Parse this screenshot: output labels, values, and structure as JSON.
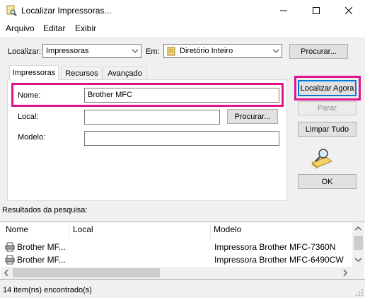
{
  "window": {
    "title": "Localizar Impressoras..."
  },
  "menu": [
    "Arquivo",
    "Editar",
    "Exibir"
  ],
  "search_bar": {
    "localizar_label": "Localizar:",
    "localizar_value": "Impressoras",
    "em_label": "Em:",
    "em_value": "Diretório Inteiro",
    "procurar_label": "Procurar..."
  },
  "tabs": [
    "Impressoras",
    "Recursos",
    "Avançado"
  ],
  "form": {
    "nome_label": "Nome:",
    "nome_value": "Brother MFC",
    "local_label": "Local:",
    "local_value": "",
    "local_procurar_label": "Procurar...",
    "modelo_label": "Modelo:",
    "modelo_value": ""
  },
  "actions": {
    "localizar_agora": "Localizar Agora",
    "parar": "Parar",
    "limpar_tudo": "Limpar Tudo",
    "ok": "OK"
  },
  "results": {
    "label": "Resultados da pesquisa:",
    "columns": [
      "Nome",
      "Local",
      "Modelo"
    ],
    "rows": [
      {
        "nome": "Brother MF...",
        "local": "",
        "modelo": "Impressora Brother MFC-7360N"
      },
      {
        "nome": "Brother MF...",
        "local": "",
        "modelo": "Impressora Brother MFC-6490CW"
      }
    ]
  },
  "status": "14 item(ns) encontrado(s)",
  "colors": {
    "highlight": "#e0148c",
    "accent": "#0078d7"
  }
}
